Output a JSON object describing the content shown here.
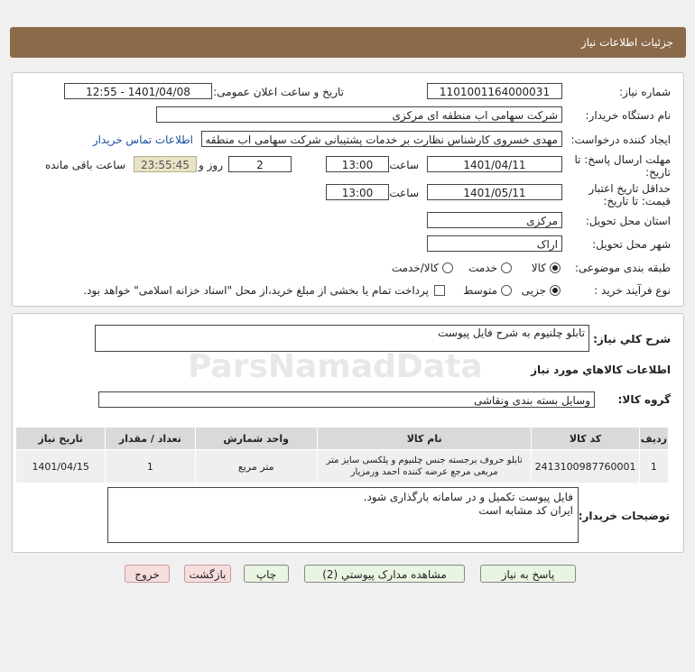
{
  "header": {
    "title": "جزئیات اطلاعات نیاز"
  },
  "details": {
    "need_number_label": "شماره نیاز:",
    "need_number": "1101001164000031",
    "announce_label": "تاریخ و ساعت اعلان عمومی:",
    "announce_value": "1401/04/08 - 12:55",
    "buyer_label": "نام دستگاه خریدار:",
    "buyer_value": "شرکت سهامی اب منطقه ای مرکزی",
    "creator_label": "ایجاد کننده درخواست:",
    "creator_value": "مهدی خسروی کارشناس نظارت بر خدمات پشتیبانی شرکت سهامی اب منطقه ای مرکزی",
    "contact_link": "اطلاعات تماس خریدار",
    "deadline_label_1": "مهلت ارسال پاسخ: تا",
    "deadline_label_2": "تاریخ:",
    "deadline_date": "1401/04/11",
    "time_label": "ساعت",
    "deadline_time": "13:00",
    "days_value": "2",
    "days_label": "روز و",
    "remaining_time": "23:55:45",
    "remaining_label": "ساعت باقی مانده",
    "validity_label_1": "حداقل تاریخ اعتبار",
    "validity_label_2": "قیمت: تا تاریخ:",
    "validity_date": "1401/05/11",
    "validity_time": "13:00",
    "province_label": "استان محل تحویل:",
    "province_value": "مرکزی",
    "city_label": "شهر محل تحویل:",
    "city_value": "اراک",
    "category_label": "طبقه بندی موضوعی:",
    "category_options": [
      "کالا",
      "خدمت",
      "کالا/خدمت"
    ],
    "process_label": "نوع فرآیند خرید :",
    "process_options": [
      "جزیی",
      "متوسط"
    ],
    "payment_note": "پرداخت تمام یا بخشی از مبلغ خرید،از محل \"اسناد خزانه اسلامی\" خواهد بود."
  },
  "description": {
    "label": "شرح كلي نياز:",
    "value": "تابلو چلنیوم به شرح فایل پیوست"
  },
  "goods": {
    "section_title": "اطلاعات كالاهاي مورد نياز",
    "group_label": "گروه كالا:",
    "group_value": "وسایل بسته بندی  ونقاشی",
    "columns": [
      "ردیف",
      "کد کالا",
      "نام کالا",
      "واحد شمارش",
      "تعداد / مقدار",
      "تاریخ نیاز"
    ],
    "rows": [
      {
        "row": "1",
        "code": "2413100987760001",
        "name": "تابلو حروف برجسته جنس چلنیوم و پلکسی سایز متر مربعی مرجع عرضه کننده احمد ورمزیار",
        "unit": "متر مربع",
        "qty": "1",
        "date": "1401/04/15"
      }
    ]
  },
  "buyer_notes": {
    "label": "توضیحات خریدار:",
    "line1": "فایل پیوست تکمیل و در سامانه بارگذاری شود.",
    "line2": "ایران کد مشابه است"
  },
  "buttons": {
    "reply": "پاسخ به نیاز",
    "attachments": "مشاهده مدارک پیوستي (2)",
    "print": "چاپ",
    "back": "بازگشت",
    "exit": "خروج"
  },
  "watermark": {
    "brand": "ParsNamadData"
  }
}
